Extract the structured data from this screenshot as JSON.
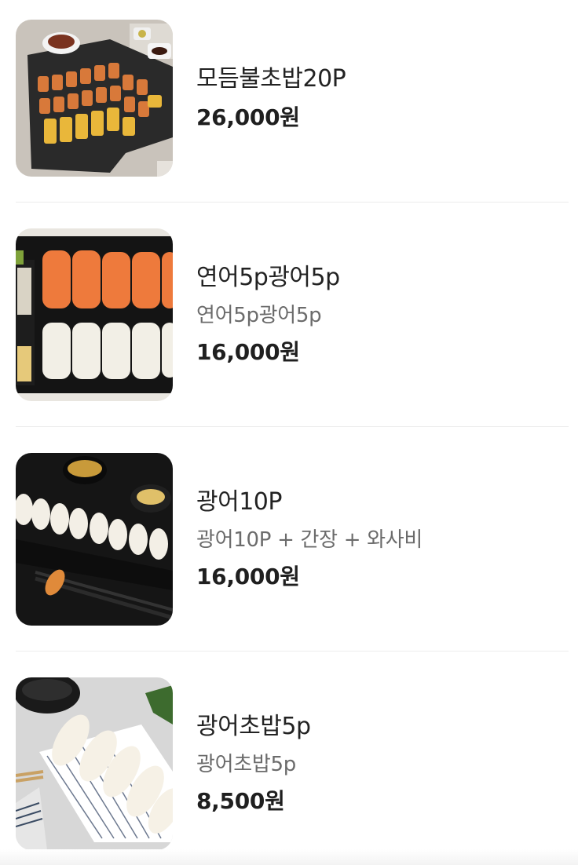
{
  "menu": {
    "items": [
      {
        "name": "모듬불초밥20P",
        "description": "",
        "price": "26,000원",
        "image_icon": "sushi-platter-photo"
      },
      {
        "name": "연어5p광어5p",
        "description": "연어5p광어5p",
        "price": "16,000원",
        "image_icon": "salmon-flatfish-sushi-photo"
      },
      {
        "name": "광어10P",
        "description": "광어10P + 간장 + 와사비",
        "price": "16,000원",
        "image_icon": "flatfish-sushi-photo"
      },
      {
        "name": "광어초밥5p",
        "description": "광어초밥5p",
        "price": "8,500원",
        "image_icon": "flatfish-nigiri-photo"
      }
    ]
  }
}
